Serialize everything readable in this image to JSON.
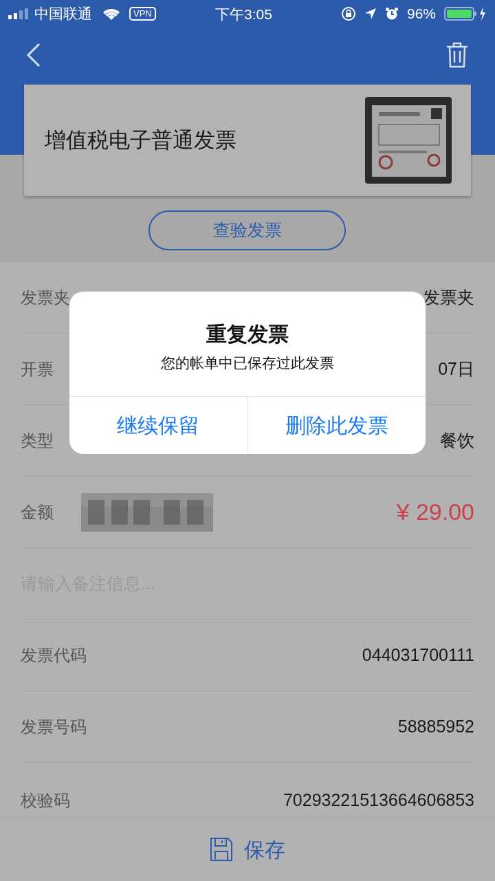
{
  "status_bar": {
    "carrier": "中国联通",
    "vpn": "VPN",
    "time": "下午3:05",
    "battery": "96%"
  },
  "card": {
    "title": "增值税电子普通发票"
  },
  "verify_button": "查验发票",
  "fields": [
    {
      "kind": "text",
      "label": "发票夹",
      "value": "发票夹"
    },
    {
      "kind": "text",
      "label": "开票",
      "value": "07日"
    },
    {
      "kind": "text",
      "label": "类型",
      "value": "餐饮"
    },
    {
      "kind": "amount",
      "label": "金额",
      "value": "¥ 29.00"
    },
    {
      "kind": "input",
      "placeholder": "请输入备注信息..."
    },
    {
      "kind": "text",
      "label": "发票代码",
      "value": "044031700111"
    },
    {
      "kind": "text",
      "label": "发票号码",
      "value": "58885952"
    },
    {
      "kind": "text",
      "label": "校验码",
      "value": "70293221513664606853"
    }
  ],
  "save_button": "保存",
  "dialog": {
    "title": "重复发票",
    "message": "您的帐单中已保存过此发票",
    "buttons": [
      "继续保留",
      "删除此发票"
    ]
  }
}
